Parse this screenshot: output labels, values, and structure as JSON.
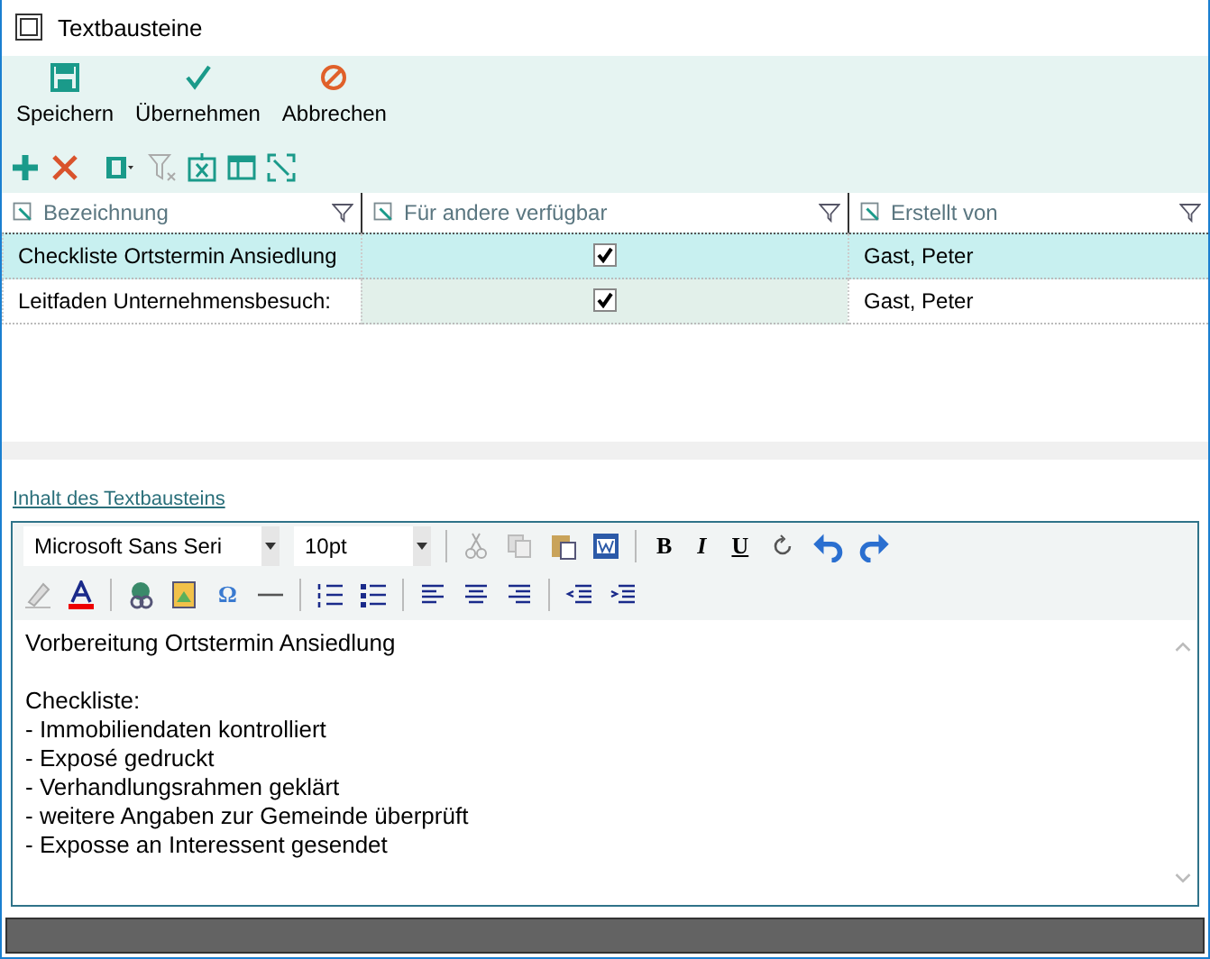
{
  "window": {
    "title": "Textbausteine"
  },
  "actions": [
    {
      "kind": "save",
      "label": "Speichern"
    },
    {
      "kind": "apply",
      "label": "Übernehmen"
    },
    {
      "kind": "cancel",
      "label": "Abbrechen"
    }
  ],
  "grid": {
    "columns": [
      {
        "label": "Bezeichnung"
      },
      {
        "label": "Für andere verfügbar"
      },
      {
        "label": "Erstellt von"
      }
    ],
    "rows": [
      {
        "name": "Checkliste Ortstermin Ansiedlung",
        "shared": true,
        "author": "Gast, Peter",
        "selected": true
      },
      {
        "name": "Leitfaden Unternehmensbesuch:",
        "shared": true,
        "author": "Gast, Peter",
        "selected": false
      }
    ]
  },
  "editor": {
    "link": "Inhalt des Textbausteins",
    "font": "Microsoft Sans Seri",
    "size": "10pt",
    "bold": "B",
    "italic": "I",
    "underline": "U",
    "symbol": "Ω",
    "paragraphs": [
      [
        "Vorbereitung Ortstermin Ansiedlung"
      ],
      [
        "Checkliste:",
        "- Immobiliendaten kontrolliert",
        "- Exposé gedruckt",
        "- Verhandlungsrahmen geklärt",
        "- weitere Angaben zur Gemeinde überprüft",
        "- Exposse an Interessent gesendet"
      ]
    ]
  }
}
